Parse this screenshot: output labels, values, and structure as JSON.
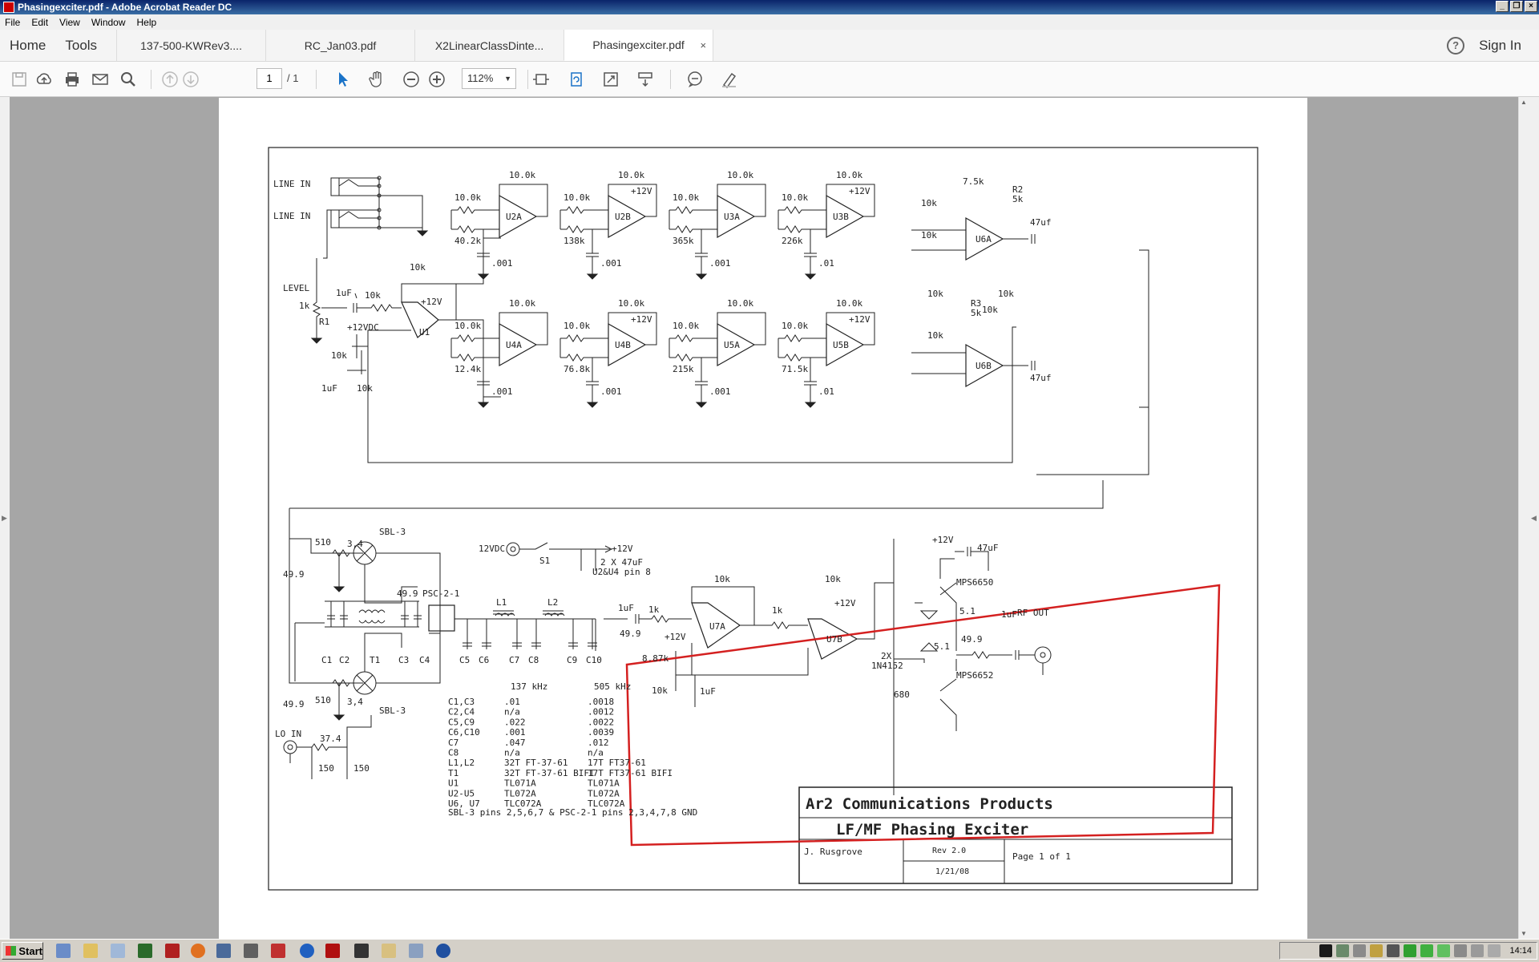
{
  "window": {
    "title": "Phasingexciter.pdf - Adobe Acrobat Reader DC"
  },
  "menu": [
    "File",
    "Edit",
    "View",
    "Window",
    "Help"
  ],
  "nav": {
    "home": "Home",
    "tools": "Tools"
  },
  "tabs": [
    "137-500-KWRev3....",
    "RC_Jan03.pdf",
    "X2LinearClassDinte...",
    "Phasingexciter.pdf"
  ],
  "active_tab_close": "×",
  "signin": "Sign In",
  "help_glyph": "?",
  "toolbar": {
    "page_current": "1",
    "page_total": "/ 1",
    "zoom": "112%"
  },
  "schematic": {
    "labels": {
      "line_in": "LINE IN",
      "level": "LEVEL",
      "r1": "R1",
      "r1_val": "1k",
      "c_1uf": "1uF",
      "vdc": "+12VDC",
      "v12": "+12V",
      "r10k": "10k",
      "r10_0k": "10.0k",
      "r40_2k": "40.2k",
      "r138k": "138k",
      "r365k": "365k",
      "r226k": "226k",
      "r12_4k": "12.4k",
      "r76_8k": "76.8k",
      "r215k": "215k",
      "r71_5k": "71.5k",
      "c001": ".001",
      "c01": ".01",
      "r7_5k": "7.5k",
      "r2": "R2",
      "r5k": "5k",
      "r3": "R3",
      "c47uf": "47uf",
      "u1": "U1",
      "u2a": "U2A",
      "u2b": "U2B",
      "u3a": "U3A",
      "u3b": "U3B",
      "u4a": "U4A",
      "u4b": "U4B",
      "u5a": "U5A",
      "u5b": "U5B",
      "u6a": "U6A",
      "u6b": "U6B",
      "sbl3": "SBL-3",
      "r510": "510",
      "r49_9": "49.9",
      "p34": "3,4",
      "psc": "PSC-2-1",
      "l1": "L1",
      "l2": "L2",
      "v12dc": "12VDC",
      "s1": "S1",
      "c2x47": "2 X 47uF",
      "u2u4pin8": "U2&U4 pin 8",
      "c1": "C1",
      "c2": "C2",
      "t1": "T1",
      "c3": "C3",
      "c4": "C4",
      "c5": "C5",
      "c6": "C6",
      "c7": "C7",
      "c8": "C8",
      "c9": "C9",
      "c10": "C10",
      "lo_in": "LO IN",
      "r37_4": "37.4",
      "r150": "150",
      "c47uF": "47uF",
      "mps6650": "MPS6650",
      "mps6652": "MPS6652",
      "r5_1": "5.1",
      "rf_out": "RF OUT",
      "r8_87k": "8.87k",
      "r1k": "1k",
      "u7a": "U7A",
      "u7b": "U7B",
      "diodes": "2X",
      "diode_type": "1N4152",
      "r680": "680"
    },
    "table": {
      "headers": [
        "",
        "137 kHz",
        "505 kHz"
      ],
      "rows": [
        [
          "C1,C3",
          ".01",
          ".0018"
        ],
        [
          "C2,C4",
          "n/a",
          ".0012"
        ],
        [
          "C5,C9",
          ".022",
          ".0022"
        ],
        [
          "C6,C10",
          ".001",
          ".0039"
        ],
        [
          "C7",
          ".047",
          ".012"
        ],
        [
          "C8",
          "n/a",
          "n/a"
        ],
        [
          "L1,L2",
          "32T FT-37-61",
          "17T FT37-61"
        ],
        [
          "T1",
          "32T FT-37-61 BIFI",
          "17T FT37-61 BIFI"
        ],
        [
          "U1",
          "TL071A",
          "TL071A"
        ],
        [
          "U2-U5",
          "TL072A",
          "TL072A"
        ],
        [
          "U6, U7",
          "TLC072A",
          "TLC072A"
        ]
      ],
      "footnote": "SBL-3 pins 2,5,6,7 & PSC-2-1 pins 2,3,4,7,8 GND"
    },
    "titleblock": {
      "company": "Ar2 Communications Products",
      "title": "LF/MF Phasing Exciter",
      "author": "J. Rusgrove",
      "rev": "Rev 2.0",
      "date": "1/21/08",
      "page": "Page 1 of 1"
    }
  },
  "taskbar": {
    "start": "Start",
    "clock": "14:14"
  },
  "colors": {
    "annotation": "#d42020",
    "viewer_bg": "#a6a6a6",
    "accent": "#1a73c8"
  }
}
